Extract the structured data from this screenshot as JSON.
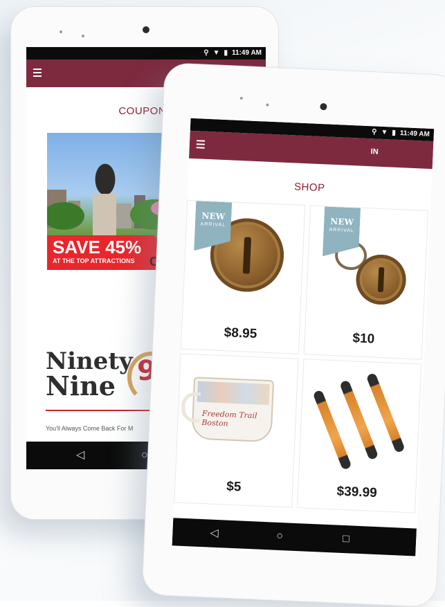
{
  "back_phone": {
    "status": {
      "time": "11:49 AM"
    },
    "page_title": "COUPONS",
    "banner": {
      "headline": "SAVE 45%",
      "subline": "AT THE TOP ATTRACTIONS",
      "cut_text": "C"
    },
    "logo": {
      "line1": "Ninety",
      "line2": "Nine",
      "number": "99"
    },
    "tagline": "You'll Always Come Back For M",
    "nav": {
      "back": "◁",
      "home": "○"
    }
  },
  "front_phone": {
    "status": {
      "time": "11:49 AM"
    },
    "appbar_partial_text": "IN",
    "page_title": "SHOP",
    "new_tag": {
      "line1": "NEW",
      "line2": "ARRIVAL"
    },
    "products": [
      {
        "price": "$8.95",
        "new": true
      },
      {
        "price": "$10",
        "new": true
      },
      {
        "price": "$5",
        "new": false,
        "mug_text": "Freedom Trail Boston"
      },
      {
        "price": "$39.99",
        "new": false
      }
    ],
    "nav": {
      "back": "◁",
      "home": "○",
      "recents": "□"
    }
  },
  "colors": {
    "brand": "#7d2a3f",
    "title": "#8b1f32",
    "sale_red": "#e8262b",
    "tag_blue": "#8fb3bf"
  },
  "icons": [
    "location-icon",
    "wifi-icon",
    "battery-icon",
    "hamburger-menu-icon",
    "back-triangle-icon",
    "home-circle-icon",
    "recents-square-icon"
  ]
}
